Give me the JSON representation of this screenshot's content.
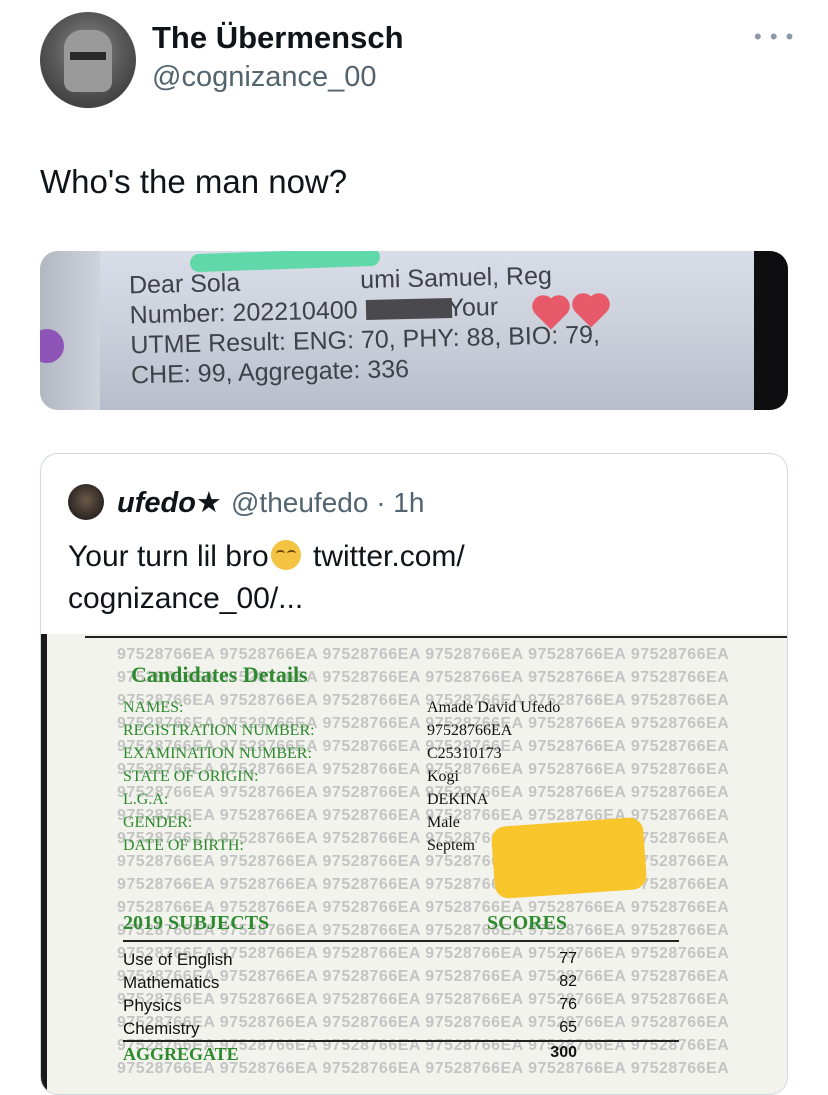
{
  "tweet": {
    "author_name": "The Übermensch",
    "author_handle": "@cognizance_00",
    "more_icon": "more-icon",
    "text": "Who's the man now?"
  },
  "media_text": [
    "Dear Sola",
    "umi Samuel, Reg",
    "Number: 202210400",
    "Your",
    "UTME Result: ENG: 70, PHY: 88, BIO: 79,",
    "CHE: 99, Aggregate: 336"
  ],
  "quoted": {
    "author_name": "ufedo★",
    "author_handle": "@theufedo · 1h",
    "text_line1": "Your turn lil bro",
    "text_link1": "twitter.com/",
    "text_line2": "cognizance_00/..."
  },
  "document": {
    "watermark": "97528766EA",
    "title": "Candidates Details",
    "fields": [
      {
        "label": "NAMES:",
        "value": "Amade David Ufedo"
      },
      {
        "label": "REGISTRATION NUMBER:",
        "value": "97528766EA"
      },
      {
        "label": "EXAMINATION NUMBER:",
        "value": "C25310173"
      },
      {
        "label": "STATE OF ORIGIN:",
        "value": "Kogi"
      },
      {
        "label": "L.G.A:",
        "value": "DEKINA"
      },
      {
        "label": "GENDER:",
        "value": "Male"
      },
      {
        "label": "DATE OF BIRTH:",
        "value": "Septem"
      }
    ],
    "subjects_header": "2019 SUBJECTS",
    "scores_header": "SCORES",
    "subjects": [
      {
        "name": "Use of English",
        "score": "77"
      },
      {
        "name": "Mathematics",
        "score": "82"
      },
      {
        "name": "Physics",
        "score": "76"
      },
      {
        "name": "Chemistry",
        "score": "65"
      }
    ],
    "aggregate_label": "AGGREGATE",
    "aggregate_value": "300"
  }
}
